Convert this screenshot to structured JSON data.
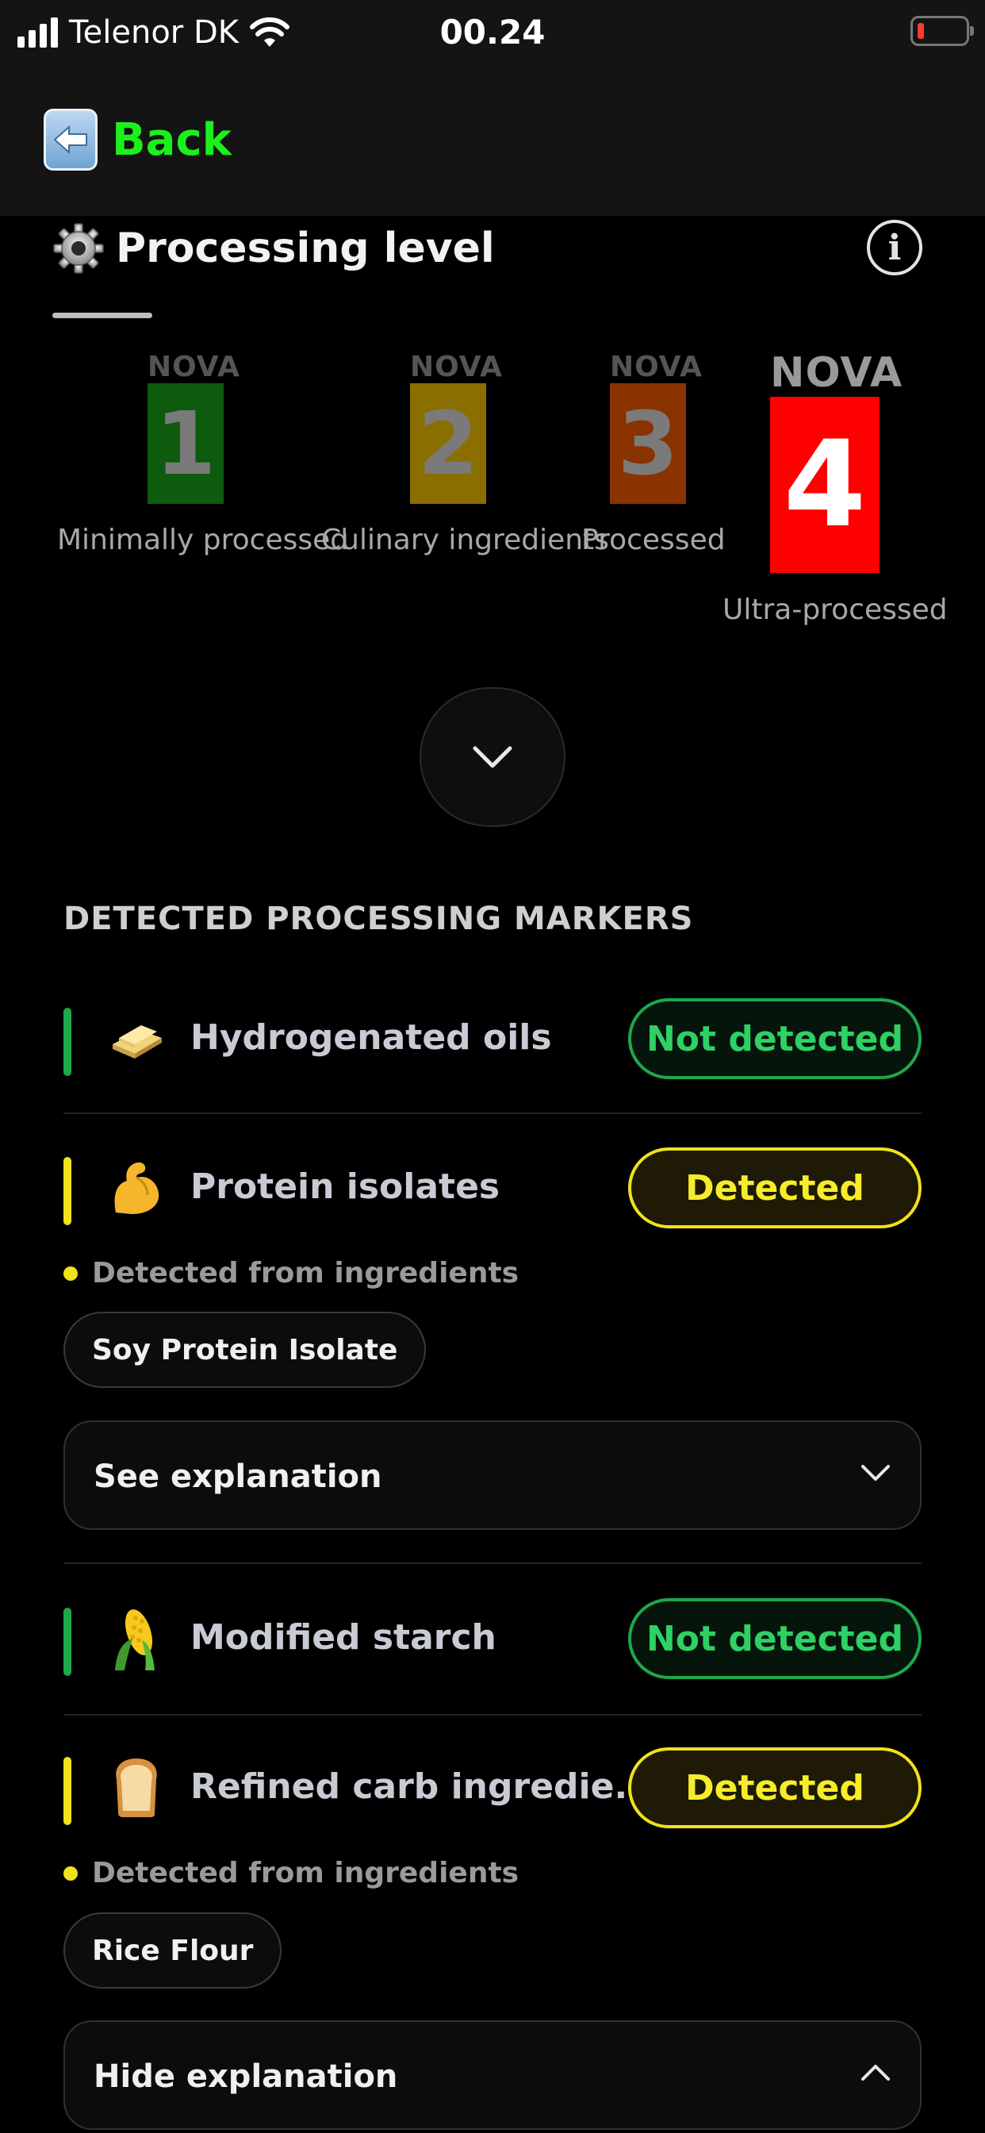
{
  "status_bar": {
    "carrier": "Telenor DK",
    "time": "00.24"
  },
  "nav": {
    "back_label": "Back"
  },
  "processing": {
    "title": "Processing level",
    "nova_word": "NOVA",
    "levels": [
      {
        "number": "1",
        "label": "Minimally processed",
        "color": "#0e5a0e"
      },
      {
        "number": "2",
        "label": "Culinary ingredients",
        "color": "#8a6f00"
      },
      {
        "number": "3",
        "label": "Processed",
        "color": "#8a3200"
      },
      {
        "number": "4",
        "label": "Ultra-processed",
        "color": "#ff0000"
      }
    ],
    "active_level": "4"
  },
  "markers": {
    "heading": "DETECTED PROCESSING MARKERS",
    "items": [
      {
        "name": "Hydrogenated oils",
        "status": "Not detected",
        "icon": "butter-icon",
        "color": "#1ea84b"
      },
      {
        "name": "Protein isolates",
        "status": "Detected",
        "icon": "flexed-biceps-icon",
        "color": "#f0e21c",
        "source": "Detected from ingredients",
        "chips": [
          "Soy Protein Isolate"
        ],
        "explanation": "See explanation"
      },
      {
        "name": "Modified starch",
        "status": "Not detected",
        "icon": "corn-icon",
        "color": "#1ea84b"
      },
      {
        "name": "Refined carb ingredie...",
        "status": "Detected",
        "icon": "bread-icon",
        "color": "#f0e21c",
        "source": "Detected from ingredients",
        "chips": [
          "Rice Flour"
        ],
        "explanation": "Hide explanation"
      }
    ]
  }
}
